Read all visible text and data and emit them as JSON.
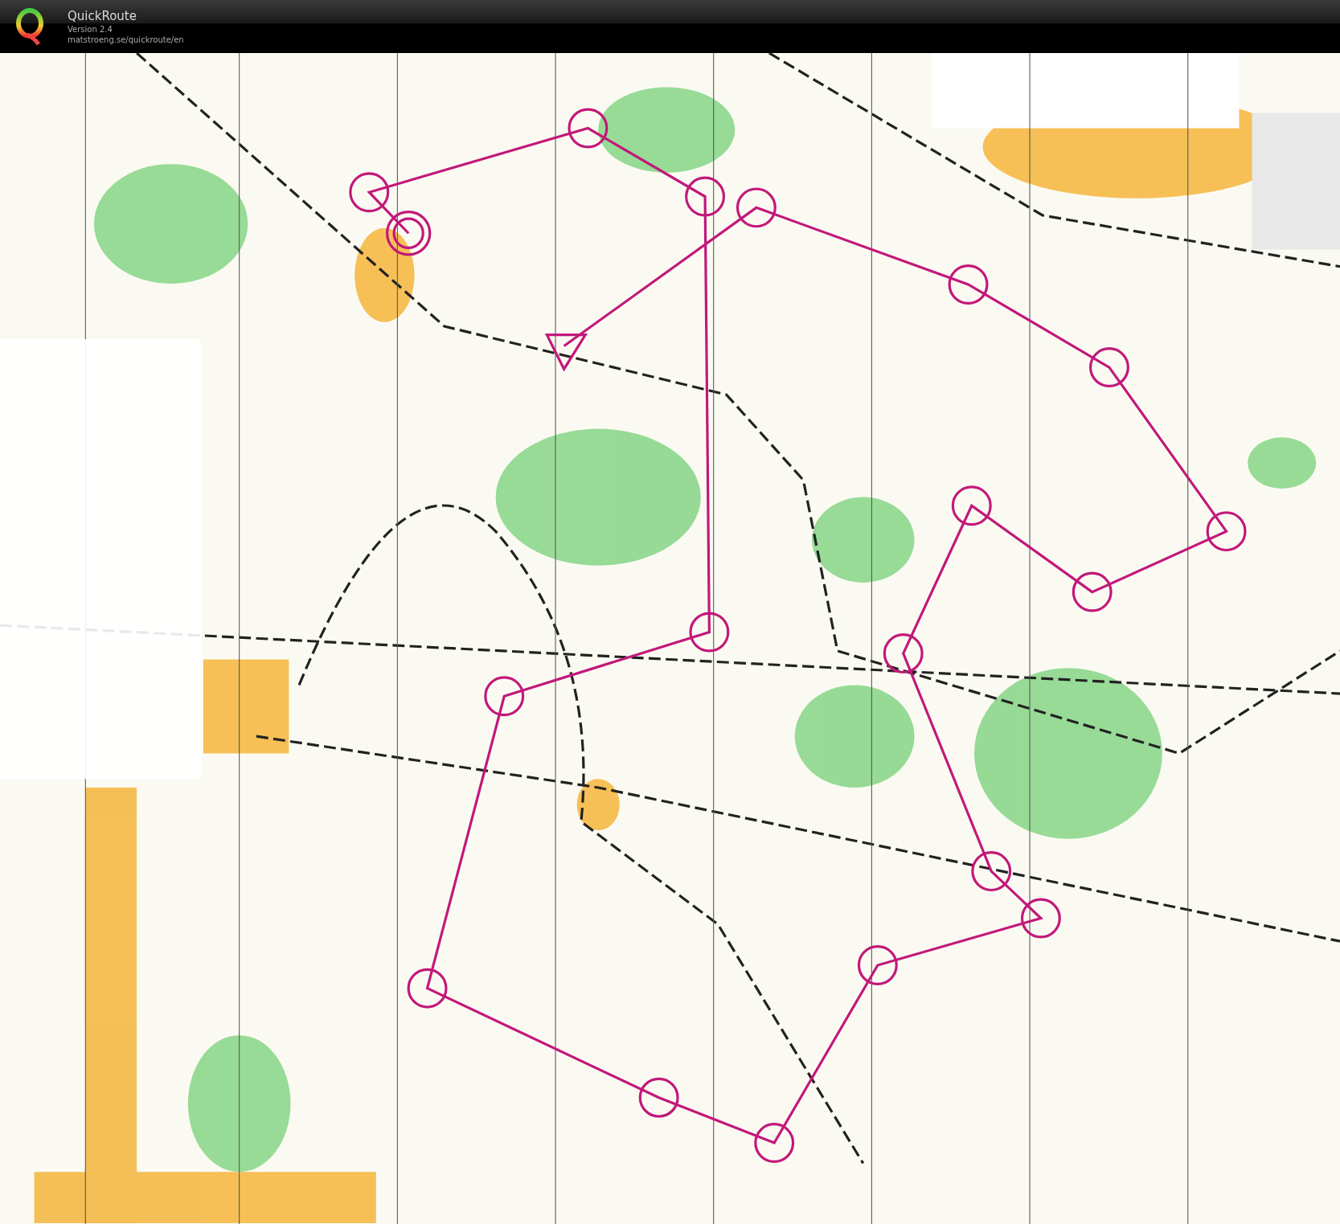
{
  "header": {
    "title": "QuickRoute",
    "version": "Version 2.4",
    "url": "matstroeng.se/quickroute/en"
  }
}
